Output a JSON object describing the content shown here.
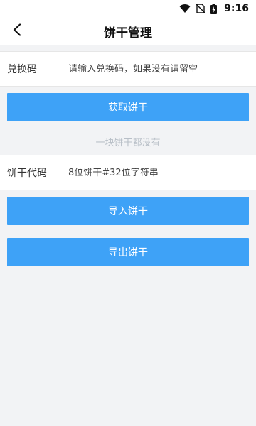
{
  "status_bar": {
    "time": "9:16",
    "icons": [
      "wifi-icon",
      "no-sim-icon",
      "battery-icon"
    ]
  },
  "header": {
    "title": "饼干管理",
    "back_icon": "chevron-left-icon"
  },
  "redeem": {
    "label": "兑换码",
    "placeholder": "请输入兑换码，如果没有请留空"
  },
  "get_button": {
    "label": "获取饼干"
  },
  "empty_message": "一块饼干都没有",
  "cookie_code": {
    "label": "饼干代码",
    "placeholder": "8位饼干#32位字符串"
  },
  "import_button": {
    "label": "导入饼干"
  },
  "export_button": {
    "label": "导出饼干"
  },
  "colors": {
    "accent": "#3ea2f7",
    "background": "#f2f3f5",
    "muted_text": "#b8bfc7"
  }
}
